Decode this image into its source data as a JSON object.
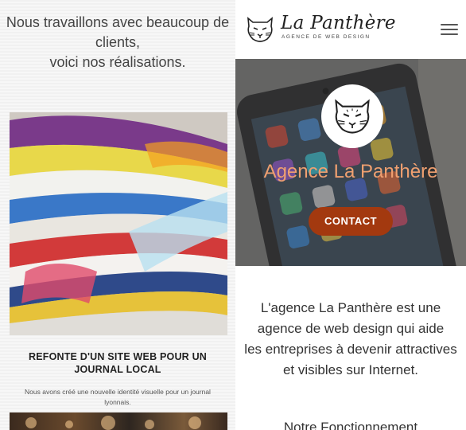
{
  "left": {
    "intro_lines": [
      "Nous travaillons avec beaucoup de",
      "clients,",
      "voici nos réalisations."
    ],
    "card": {
      "image_icon": "magazines-stack-photo",
      "title": "REFONTE D'UN SITE WEB POUR UN JOURNAL LOCAL",
      "description": "Nous avons créé une nouvelle identité visuelle pour un journal lyonnais."
    },
    "next_card_image_icon": "bokeh-lights-photo"
  },
  "right": {
    "logo": {
      "icon": "panther-head-icon",
      "title": "La Panthère",
      "subtitle": "AGENCE DE WEB DESIGN"
    },
    "menu_icon": "hamburger-menu-icon",
    "banner": {
      "background": "phone-on-table-photo",
      "icon": "panther-head-icon",
      "title": "Agence La Panthère",
      "title_color": "#f0a070",
      "button_label": "CONTACT",
      "button_color": "#a3390f"
    },
    "about_lines": [
      "L'agence La Panthère est une",
      "agence de web design qui aide",
      "les entreprises à devenir attractives",
      "et visibles sur Internet."
    ],
    "next_heading": "Notre Fonctionnement"
  }
}
